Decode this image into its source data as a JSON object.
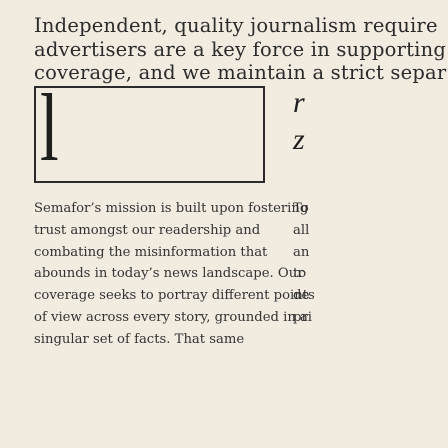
{
  "headline": {
    "lines": [
      "Independent, quality journalism require",
      "advertisers are a key force in supporting",
      "coverage, and we maintain a strict separ"
    ]
  },
  "card": {
    "glyph": "l"
  },
  "side_glyphs": {
    "top": "r",
    "bottom": "z"
  },
  "body_left": {
    "lines": [
      "Semafor’s mission is built upon fostering",
      "trust amongst our readership and",
      "combating the misinformation that",
      "abounds in today’s news landscape. Our",
      "coverage seeks to portray different points",
      "of view across every story, grounded in a",
      "singular set of facts. That same"
    ]
  },
  "body_right": {
    "lines": [
      "To",
      "all",
      "an",
      "to",
      "de",
      "pri"
    ]
  }
}
